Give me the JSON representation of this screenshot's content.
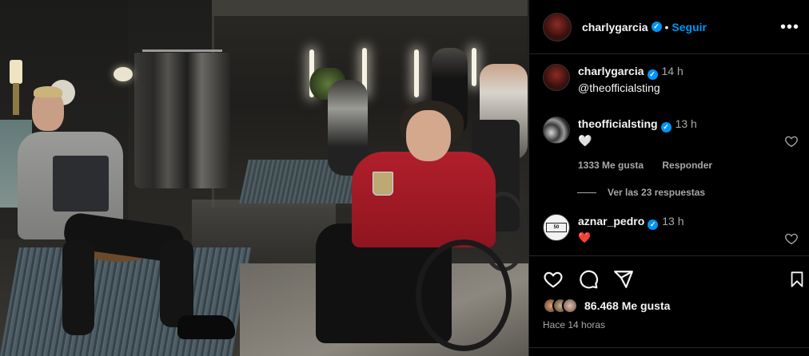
{
  "post": {
    "author": "charlygarcia",
    "follow_label": "Seguir",
    "separator": "•",
    "more_icon": "more-horizontal-icon"
  },
  "caption": {
    "author": "charlygarcia",
    "time": "14 h",
    "text": "@theofficialsting"
  },
  "comments": [
    {
      "author": "theofficialsting",
      "time": "13 h",
      "text": "🤍",
      "likes": "1333 Me gusta",
      "reply_label": "Responder",
      "view_replies": "Ver las 23 respuestas"
    },
    {
      "author": "aznar_pedro",
      "time": "13 h",
      "text": "❤️",
      "avatar_logo": "50"
    }
  ],
  "actions": {
    "likes": "86.468 Me gusta",
    "time_ago": "Hace 14 horas",
    "icons": [
      "heart-icon",
      "comment-icon",
      "share-icon",
      "bookmark-icon"
    ]
  },
  "colors": {
    "accent": "#0095f6",
    "background": "#000000",
    "muted": "#a8a8a8",
    "like_red": "#ff3040"
  }
}
